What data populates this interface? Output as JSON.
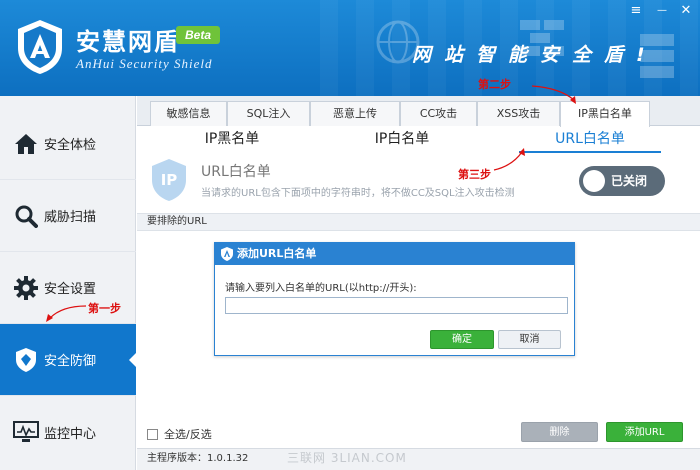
{
  "header": {
    "title": "安慧网盾",
    "beta": "Beta",
    "subtitle": "AnHui Security Shield",
    "slogan": "网站智能安全盾!",
    "menu_glyph": "≡",
    "minimize_glyph": "—",
    "close_glyph": "✕",
    "brand_color": "#0d6fc0",
    "beta_color": "#6fc33a"
  },
  "sidebar": {
    "items": [
      {
        "label": "安全体检",
        "icon": "home-icon"
      },
      {
        "label": "威胁扫描",
        "icon": "magnifier-icon"
      },
      {
        "label": "安全设置",
        "icon": "gear-icon"
      },
      {
        "label": "安全防御",
        "icon": "shield-icon",
        "active": true
      },
      {
        "label": "监控中心",
        "icon": "monitor-icon"
      }
    ],
    "active_color": "#1177cc"
  },
  "tabs": [
    {
      "label": "敏感信息"
    },
    {
      "label": "SQL注入"
    },
    {
      "label": "恶意上传"
    },
    {
      "label": "CC攻击"
    },
    {
      "label": "XSS攻击"
    },
    {
      "label": "IP黑白名单",
      "active": true
    }
  ],
  "subtabs": [
    {
      "label": "IP黑名单"
    },
    {
      "label": "IP白名单"
    },
    {
      "label": "URL白名单",
      "active": true
    }
  ],
  "url_panel": {
    "icon_text": "IP",
    "title": "URL白名单",
    "description": "当请求的URL包含下面项中的字符串时，将不做CC及SQL注入攻击检测",
    "toggle_label": "已关闭",
    "toggle_on": false
  },
  "list_header": "要排除的URL",
  "dialog": {
    "title": "添加URL白名单",
    "prompt": "请输入要列入白名单的URL(以http://开头):",
    "input_value": "",
    "ok_label": "确定",
    "cancel_label": "取消"
  },
  "footer": {
    "select_all_label": "全选/反选",
    "delete_label": "删除",
    "add_label": "添加URL",
    "version": "主程序版本：1.0.1.32",
    "watermark": "三联网 3LIAN.COM"
  },
  "annotations": {
    "step1": "第一步",
    "step2": "第二步",
    "step3": "第三步",
    "color": "#dd1111"
  }
}
